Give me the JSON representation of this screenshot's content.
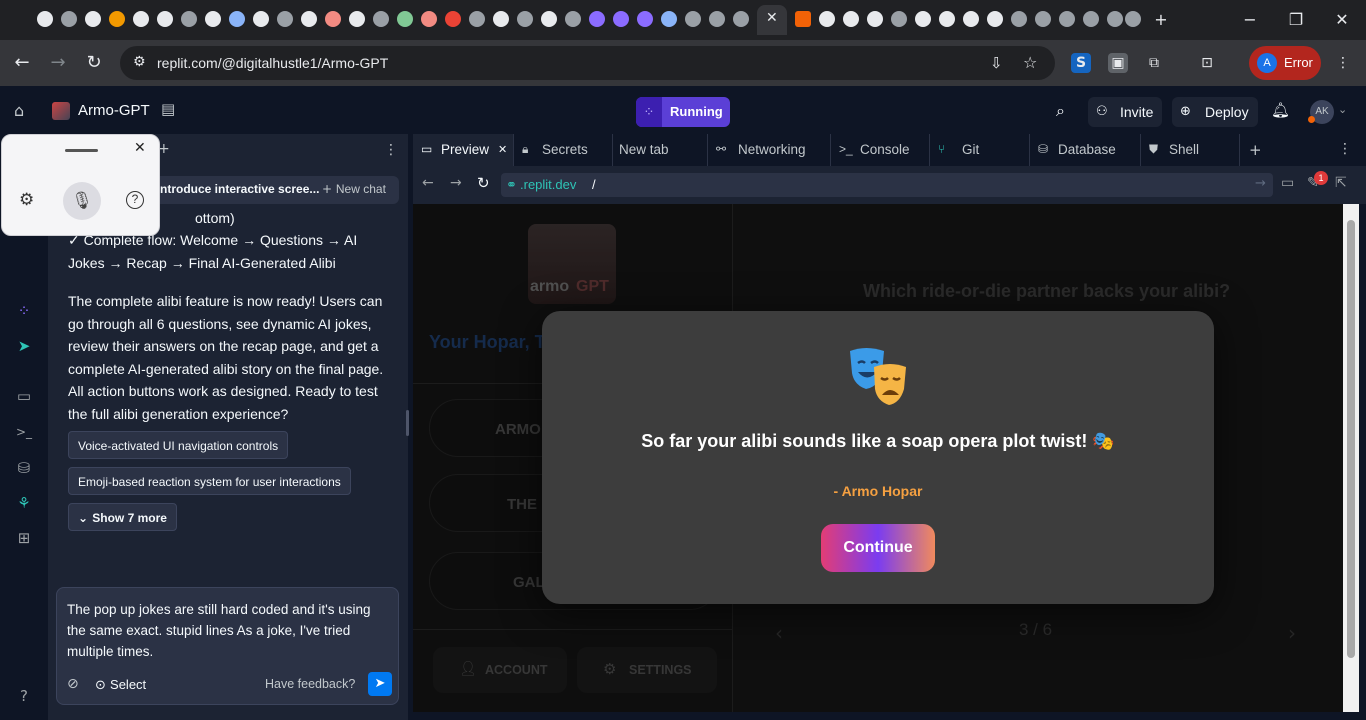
{
  "browser": {
    "url_prefix": "replit.com",
    "url_path": "/@digitalhustle1/Armo-GPT",
    "profile_initial": "A",
    "profile_status": "Error"
  },
  "header": {
    "project_name": "Armo-GPT",
    "run_status": "Running",
    "invite_label": "Invite",
    "deploy_label": "Deploy",
    "avatar_initials": "AK"
  },
  "agent": {
    "chat_title": "ntroduce interactive scree...",
    "new_chat_label": "New chat",
    "line_partial": "ottom)",
    "flow_line": "✓ Complete flow: Welcome → Questions → AI Jokes → Recap → Final AI-Generated Alibi",
    "summary": "The complete alibi feature is now ready! Users can go through all 6 questions, see dynamic AI jokes, review their answers on the recap page, and get a complete AI-generated alibi story on the final page. All action buttons work as designed. Ready to test the full alibi generation experience?",
    "suggestions": [
      "Voice-activated UI navigation controls",
      "Emoji-based reaction system for user interactions"
    ],
    "show_more": "Show 7 more",
    "input_text": "The pop up jokes are still hard coded and it's using the same exact. stupid lines As a joke, I've tried multiple times.",
    "select_label": "Select",
    "feedback_label": "Have feedback?"
  },
  "workspace": {
    "tabs": [
      "Preview",
      "Secrets",
      "New tab",
      "Networking",
      "Console",
      "Git",
      "Database",
      "Shell"
    ],
    "preview_url": ".replit.dev",
    "preview_url_suffix": "/",
    "notification_count": "1"
  },
  "app": {
    "logo_text": "armo",
    "logo_text_accent": "GPT",
    "greeting": "Your Hopar, T",
    "question": "Which ride-or-die partner backs your alibi?",
    "nav_items": [
      "ARMO",
      "THE",
      "GAL"
    ],
    "account_label": "ACCOUNT",
    "settings_label": "SETTINGS",
    "progress": "3 / 6"
  },
  "modal": {
    "joke": "So far your alibi sounds like a soap opera plot twist! 🎭",
    "attribution": "- Armo Hopar",
    "button_label": "Continue"
  },
  "colors": {
    "replit_bg": "#0e1525",
    "panel_bg": "#1c2333",
    "running_purple": "#5b3fd6",
    "error_red": "#b3261e",
    "attribution_orange": "#f5a041"
  }
}
